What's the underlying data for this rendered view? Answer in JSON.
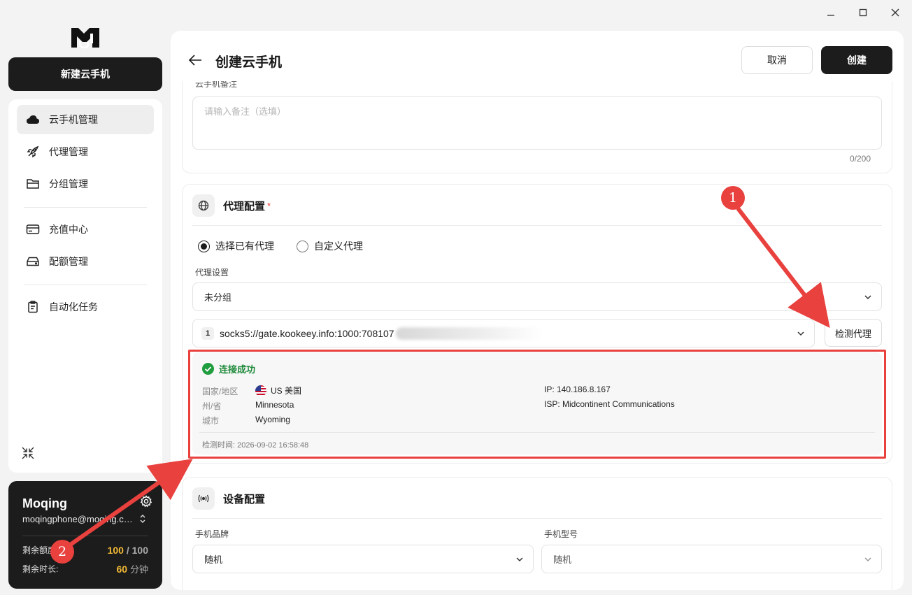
{
  "window": {
    "minimize_icon": "minimize-icon",
    "maximize_icon": "maximize-icon",
    "close_icon": "close-icon"
  },
  "sidebar": {
    "new_button": "新建云手机",
    "items": [
      {
        "label": "云手机管理",
        "icon": "cloud-icon",
        "active": true
      },
      {
        "label": "代理管理",
        "icon": "rocket-icon"
      },
      {
        "label": "分组管理",
        "icon": "folder-icon"
      },
      {
        "label": "充值中心",
        "icon": "credit-card-icon"
      },
      {
        "label": "配额管理",
        "icon": "storage-icon"
      },
      {
        "label": "自动化任务",
        "icon": "clipboard-icon"
      }
    ]
  },
  "user": {
    "name": "Moqing",
    "email": "moqingphone@moqing.com",
    "quota_label": "剩余额度",
    "quota_used": "100",
    "quota_sep": "/",
    "quota_total": "100",
    "time_label": "剩余时长:",
    "time_value": "60",
    "time_unit": "分钟"
  },
  "header": {
    "title": "创建云手机",
    "cancel": "取消",
    "create": "创建"
  },
  "note": {
    "label": "云手机备注",
    "placeholder": "请输入备注（选填）",
    "count": "0/200"
  },
  "proxy": {
    "title": "代理配置",
    "required_mark": "*",
    "radio_existing": "选择已有代理",
    "radio_custom": "自定义代理",
    "settings_label": "代理设置",
    "group_value": "未分组",
    "proxy_index": "1",
    "proxy_value": "socks5://gate.kookeey.info:1000:708107",
    "check_button": "检测代理",
    "result": {
      "status": "连接成功",
      "country_label": "国家/地区",
      "country_value": "US 美国",
      "state_label": "州/省",
      "state_value": "Minnesota",
      "city_label": "城市",
      "city_value": "Wyoming",
      "ip": "IP: 140.186.8.167",
      "isp": "ISP: Midcontinent Communications",
      "checked_at": "检测时间: 2026-09-02 16:58:48"
    }
  },
  "device": {
    "title": "设备配置",
    "brand_label": "手机品牌",
    "brand_value": "随机",
    "model_label": "手机型号",
    "model_value": "随机"
  },
  "annotations": {
    "marker_1": "1",
    "marker_2": "2",
    "color": "#e8413e"
  }
}
